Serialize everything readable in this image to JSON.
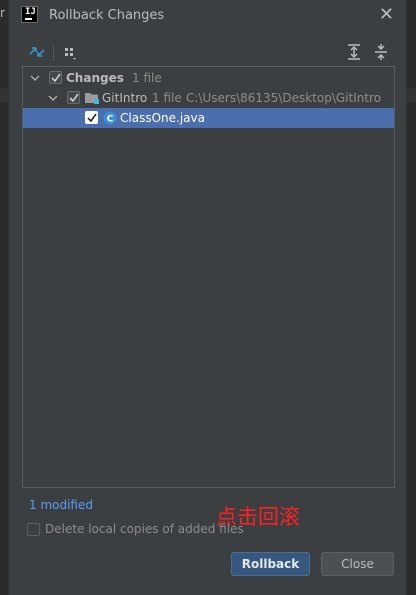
{
  "window": {
    "title": "Rollback Changes",
    "app_icon_text": "IJ"
  },
  "edge": {
    "left_char": "r"
  },
  "tree": {
    "root": {
      "label": "Changes",
      "count": "1 file"
    },
    "folder": {
      "label": "GitIntro",
      "count": "1 file",
      "path": "C:\\Users\\86135\\Desktop\\GitIntro"
    },
    "file": {
      "label": "ClassOne.java"
    }
  },
  "footer": {
    "modified_text": "1 modified",
    "delete_option_label": "Delete local copies of added files",
    "annotation": "点击回滚"
  },
  "buttons": {
    "rollback_label": "Rollback",
    "close_label": "Close"
  },
  "colors": {
    "selection": "#4b6eaf",
    "link": "#589df6",
    "primary_button": "#365880",
    "annotation": "#ff2020",
    "java_class_icon": "#3d8fd1",
    "folder_badge": "#40b6e0"
  }
}
